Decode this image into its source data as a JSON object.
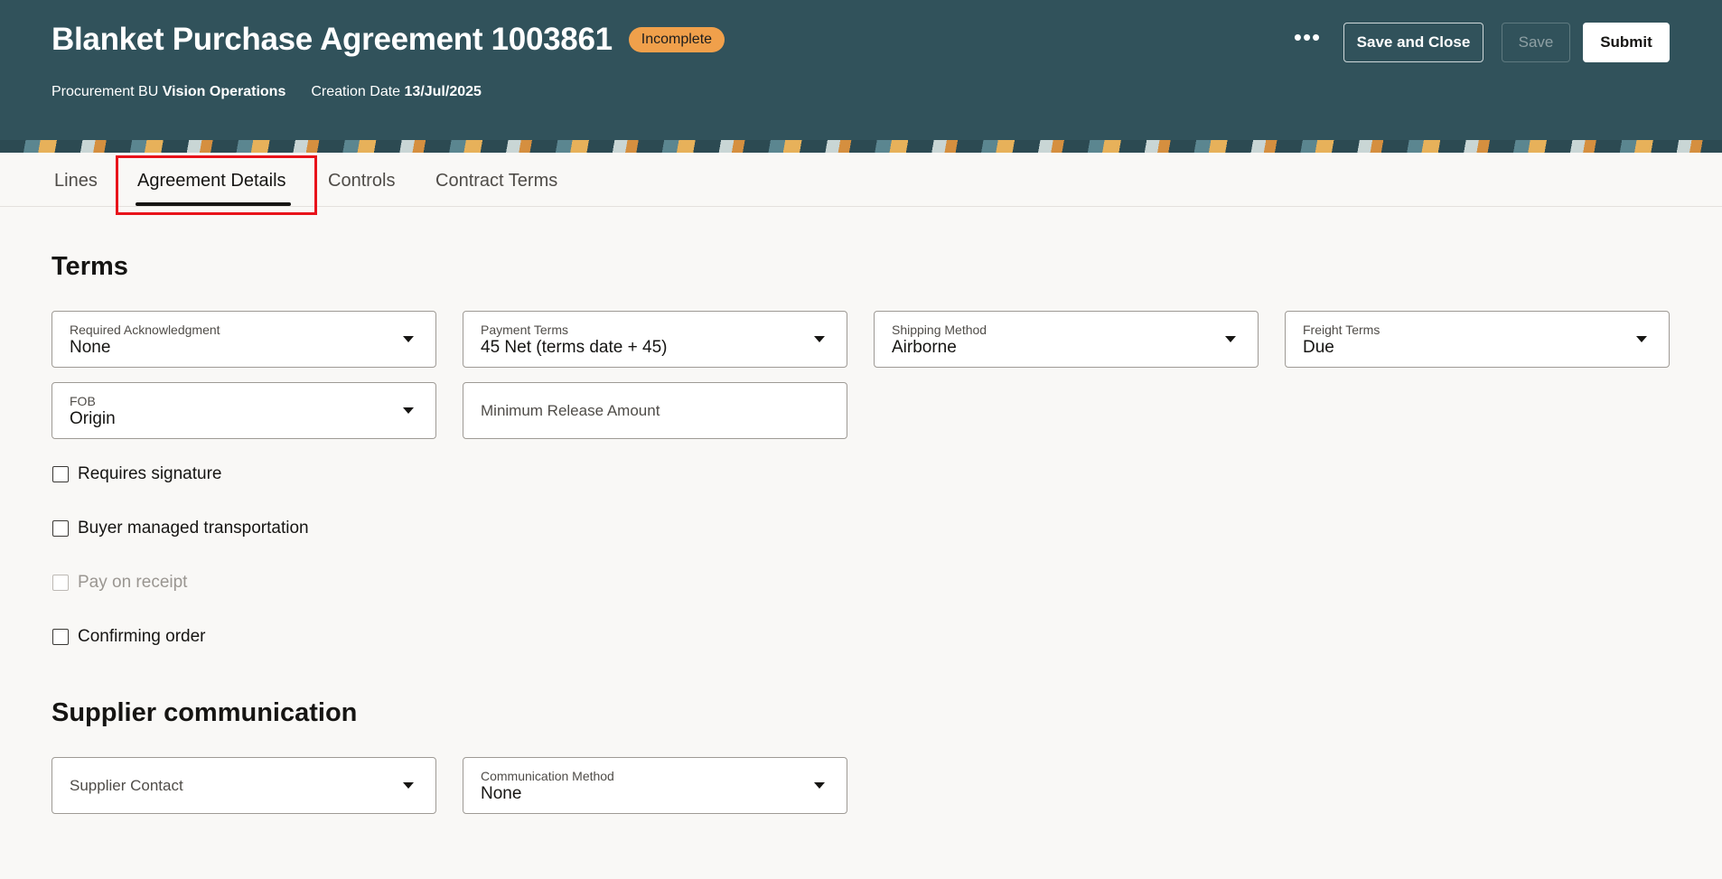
{
  "header": {
    "title": "Blanket Purchase Agreement 1003861",
    "status": "Incomplete",
    "procurement_bu_label": "Procurement BU",
    "procurement_bu_value": "Vision Operations",
    "creation_date_label": "Creation Date",
    "creation_date_value": "13/Jul/2025",
    "more_label": "•••",
    "save_close_label": "Save and Close",
    "save_label": "Save",
    "submit_label": "Submit"
  },
  "tabs": [
    {
      "label": "Lines"
    },
    {
      "label": "Agreement Details"
    },
    {
      "label": "Controls"
    },
    {
      "label": "Contract Terms"
    }
  ],
  "terms": {
    "heading": "Terms",
    "required_ack": {
      "label": "Required Acknowledgment",
      "value": "None"
    },
    "payment_terms": {
      "label": "Payment Terms",
      "value": "45 Net (terms date + 45)"
    },
    "shipping_method": {
      "label": "Shipping Method",
      "value": "Airborne"
    },
    "freight_terms": {
      "label": "Freight Terms",
      "value": "Due"
    },
    "fob": {
      "label": "FOB",
      "value": "Origin"
    },
    "min_release": {
      "placeholder": "Minimum Release Amount"
    },
    "checkboxes": [
      {
        "label": "Requires signature",
        "checked": false,
        "disabled": false
      },
      {
        "label": "Buyer managed transportation",
        "checked": false,
        "disabled": false
      },
      {
        "label": "Pay on receipt",
        "checked": false,
        "disabled": true
      },
      {
        "label": "Confirming order",
        "checked": false,
        "disabled": false
      }
    ]
  },
  "supplier_communication": {
    "heading": "Supplier communication",
    "supplier_contact": {
      "placeholder": "Supplier Contact"
    },
    "communication_method": {
      "label": "Communication Method",
      "value": "None"
    }
  },
  "colors": {
    "header_bg": "#31525b",
    "badge_bg": "#f0a04b",
    "highlight": "#e8131b"
  }
}
